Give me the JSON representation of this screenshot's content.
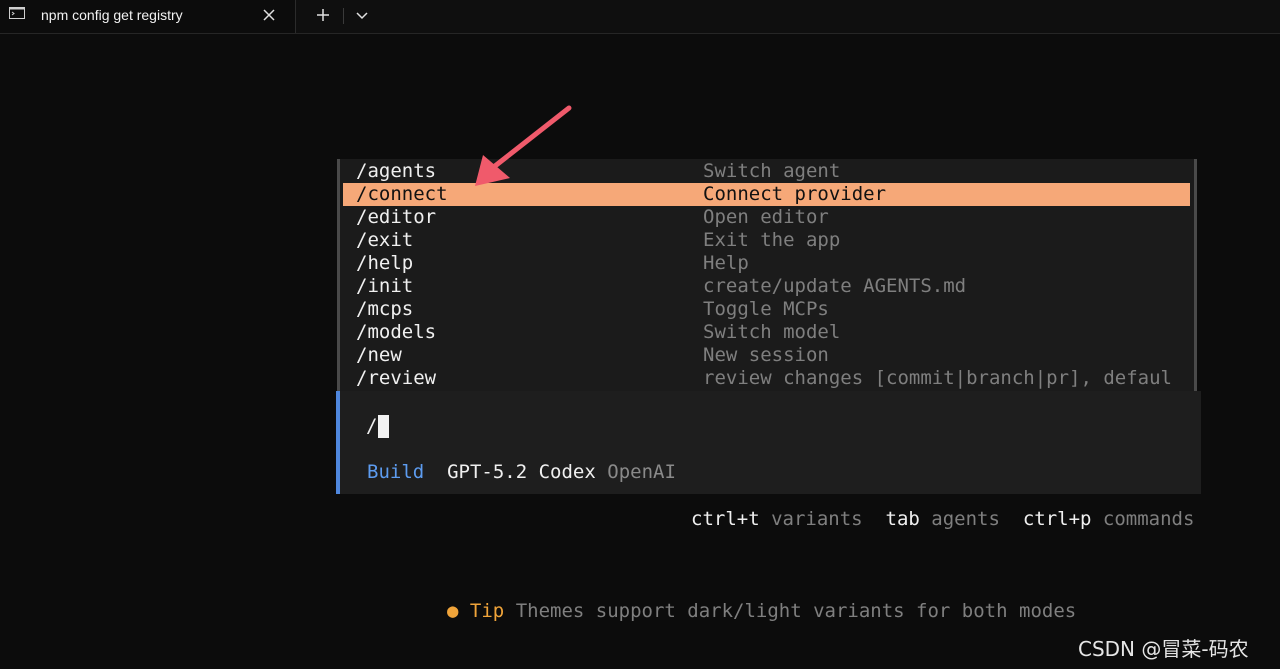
{
  "window": {
    "tab_title": "npm config get registry"
  },
  "menu": {
    "items": [
      {
        "command": "/agents",
        "description": "Switch agent"
      },
      {
        "command": "/connect",
        "description": "Connect provider"
      },
      {
        "command": "/editor",
        "description": "Open editor"
      },
      {
        "command": "/exit",
        "description": "Exit the app"
      },
      {
        "command": "/help",
        "description": "Help"
      },
      {
        "command": "/init",
        "description": "create/update AGENTS.md"
      },
      {
        "command": "/mcps",
        "description": "Toggle MCPs"
      },
      {
        "command": "/models",
        "description": "Switch model"
      },
      {
        "command": "/new",
        "description": "New session"
      },
      {
        "command": "/review",
        "description": "review changes [commit|branch|pr], defaul"
      }
    ],
    "selected_command": "/connect"
  },
  "input": {
    "value": "/"
  },
  "status": {
    "agent": "Build",
    "model": "GPT-5.2 Codex",
    "provider": "OpenAI"
  },
  "hints": [
    {
      "key": "ctrl+t",
      "label": "variants"
    },
    {
      "key": "tab",
      "label": "agents"
    },
    {
      "key": "ctrl+p",
      "label": "commands"
    }
  ],
  "tip": {
    "label": "Tip",
    "text": "Themes support dark/light variants for both modes"
  },
  "watermark": "CSDN @冒菜-码农",
  "colors": {
    "selection": "#f6a878",
    "agent_accent": "#5d9cf0",
    "tip_accent": "#f0a43a",
    "annotation_arrow": "#f05a6b"
  },
  "icons": {
    "tab": "terminal-icon",
    "close": "close-icon",
    "new_tab": "plus-icon",
    "dropdown": "chevron-down-icon",
    "annotation": "arrow-annotation-icon"
  }
}
